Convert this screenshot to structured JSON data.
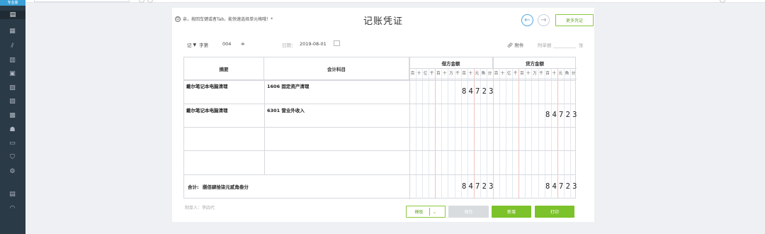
{
  "sidebar": {
    "brand": "专业版",
    "icons": [
      "voucher-icon",
      "ledger-icon",
      "chart-icon",
      "building-icon",
      "calendar-icon",
      "report-icon",
      "cashier-icon",
      "invoice-icon",
      "stamp-icon",
      "tax-icon",
      "shield-icon",
      "settings-icon",
      "archive-icon",
      "speed-icon"
    ]
  },
  "tip": "亲，按回车键或者Tab，能快速选择单元格哦！*",
  "title": "记账凭证",
  "more_button": "更多凭证",
  "header": {
    "voucher_type": "记",
    "voucher_no_label": "字第",
    "voucher_no": "004",
    "date_label": "日期：",
    "date_value": "2019-08-01",
    "attachment_label": "附件",
    "attachment_count_label": "附单据",
    "attachment_unit": "张"
  },
  "table": {
    "col_summary": "摘要",
    "col_account": "会计科目",
    "col_debit": "借方金额",
    "col_credit": "贷方金额",
    "digit_units": [
      "百",
      "十",
      "亿",
      "千",
      "百",
      "十",
      "万",
      "千",
      "百",
      "十",
      "元",
      "角",
      "分"
    ],
    "rows": [
      {
        "summary": "戴尔笔记本电脑清理",
        "account": "1606 固定资产清理",
        "debit": "84723",
        "credit": ""
      },
      {
        "summary": "戴尔笔记本电脑清理",
        "account": "6301 营业外收入",
        "debit": "",
        "credit": "84723"
      },
      {
        "summary": "",
        "account": "",
        "debit": "",
        "credit": ""
      },
      {
        "summary": "",
        "account": "",
        "debit": "",
        "credit": ""
      }
    ],
    "total_label": "合计:",
    "total_words": "捌佰肆拾柒元贰角叁分",
    "total_debit": "84723",
    "total_credit": "84723"
  },
  "maker": "制单人：李四代",
  "buttons": {
    "template": "模板",
    "save": "保存",
    "new": "新增",
    "print": "打印"
  }
}
